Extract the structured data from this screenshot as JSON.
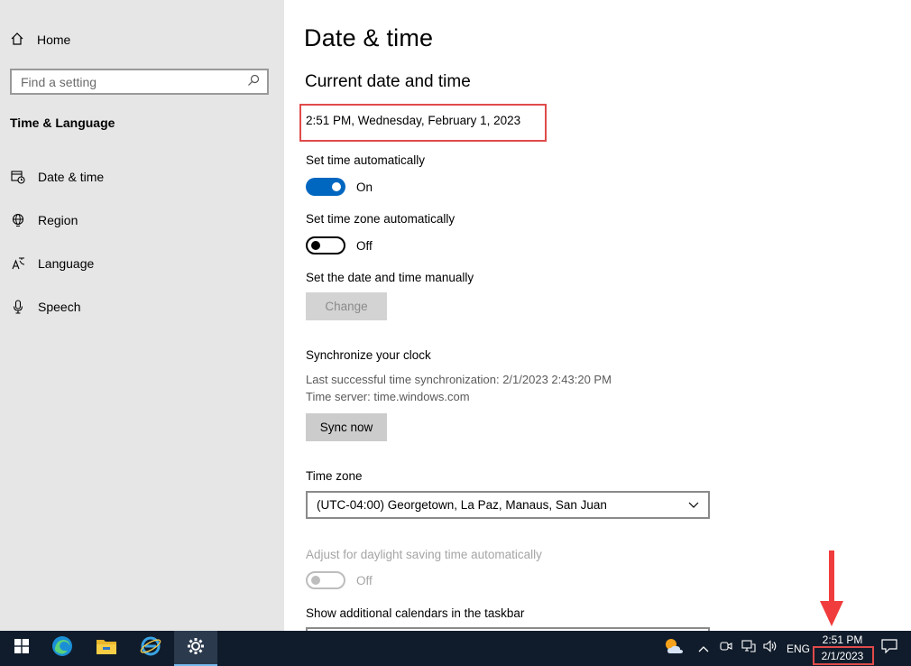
{
  "sidebar": {
    "home_label": "Home",
    "search_placeholder": "Find a setting",
    "section_title": "Time & Language",
    "items": [
      {
        "label": "Date & time",
        "icon": "calendar-clock-icon"
      },
      {
        "label": "Region",
        "icon": "globe-icon"
      },
      {
        "label": "Language",
        "icon": "language-icon"
      },
      {
        "label": "Speech",
        "icon": "microphone-icon"
      }
    ]
  },
  "main": {
    "title": "Date & time",
    "subtitle": "Current date and time",
    "current_datetime": "2:51 PM, Wednesday, February 1, 2023",
    "set_time_auto": {
      "label": "Set time automatically",
      "state": "On"
    },
    "set_zone_auto": {
      "label": "Set time zone automatically",
      "state": "Off"
    },
    "manual": {
      "label": "Set the date and time manually",
      "button": "Change"
    },
    "sync": {
      "heading": "Synchronize your clock",
      "last_sync": "Last successful time synchronization: 2/1/2023 2:43:20 PM",
      "server": "Time server: time.windows.com",
      "button": "Sync now"
    },
    "timezone": {
      "label": "Time zone",
      "value": "(UTC-04:00) Georgetown, La Paz, Manaus, San Juan"
    },
    "dst": {
      "label": "Adjust for daylight saving time automatically",
      "state": "Off"
    },
    "calendars_label": "Show additional calendars in the taskbar"
  },
  "taskbar": {
    "apps": [
      "windows-start-icon",
      "edge-icon",
      "file-explorer-icon",
      "internet-explorer-icon",
      "settings-gear-icon"
    ],
    "language": "ENG",
    "time": "2:51 PM",
    "date": "2/1/2023"
  },
  "colors": {
    "accent": "#0067c0",
    "highlight": "#e04a4a",
    "taskbar": "#101c2b"
  }
}
